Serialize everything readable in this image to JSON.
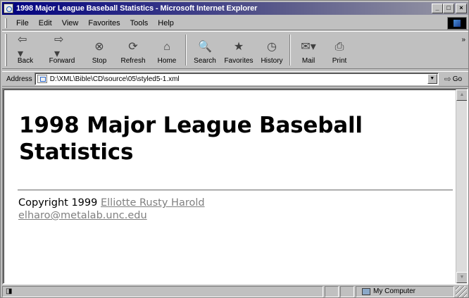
{
  "window": {
    "title": "1998 Major League Baseball Statistics - Microsoft Internet Explorer",
    "controls": {
      "minimize": "_",
      "maximize": "□",
      "close": "×"
    }
  },
  "menu": [
    "File",
    "Edit",
    "View",
    "Favorites",
    "Tools",
    "Help"
  ],
  "toolbar": {
    "buttons": [
      {
        "label": "Back",
        "icon": "back-arrow-icon"
      },
      {
        "label": "Forward",
        "icon": "forward-arrow-icon"
      },
      {
        "label": "Stop",
        "icon": "stop-icon"
      },
      {
        "label": "Refresh",
        "icon": "refresh-icon"
      },
      {
        "label": "Home",
        "icon": "home-icon"
      },
      {
        "label": "Search",
        "icon": "search-icon"
      },
      {
        "label": "Favorites",
        "icon": "favorites-icon"
      },
      {
        "label": "History",
        "icon": "history-icon"
      },
      {
        "label": "Mail",
        "icon": "mail-icon"
      },
      {
        "label": "Print",
        "icon": "print-icon"
      }
    ],
    "more": "»"
  },
  "address": {
    "label": "Address",
    "value": "D:\\XML\\Bible\\CD\\source\\05\\styled5-1.xml",
    "go_label": "Go"
  },
  "page": {
    "heading": "1998 Major League Baseball Statistics",
    "copyright_prefix": "Copyright 1999 ",
    "author_link": "Elliotte Rusty Harold",
    "email_link": "elharo@metalab.unc.edu"
  },
  "status": {
    "main": "",
    "zone": "My Computer"
  },
  "colors": {
    "titlebar_start": "#000080",
    "link": "#808080",
    "chrome": "#c0c0c0"
  }
}
